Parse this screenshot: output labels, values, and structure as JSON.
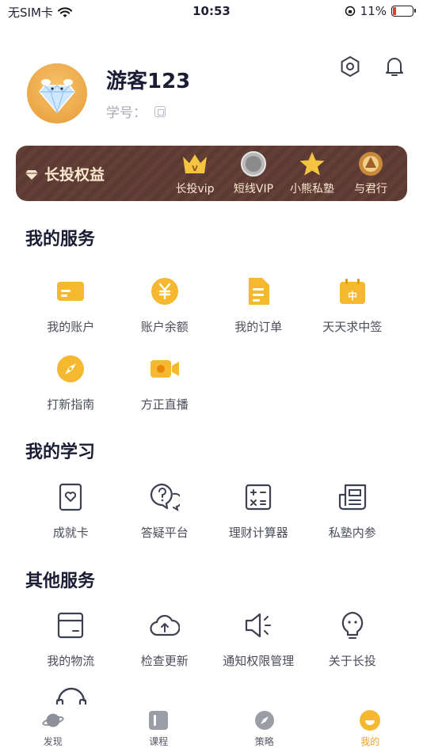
{
  "status_bar": {
    "carrier": "无SIM卡",
    "time": "10:53",
    "battery": "11%"
  },
  "profile": {
    "username": "游客123",
    "student_id_label": "学号："
  },
  "rights_banner": {
    "title": "长投权益",
    "perks": [
      {
        "label": "长投vip",
        "icon": "crown-icon"
      },
      {
        "label": "短线VIP",
        "icon": "coin-icon"
      },
      {
        "label": "小熊私塾",
        "icon": "star-icon"
      },
      {
        "label": "与君行",
        "icon": "emblem-icon"
      }
    ]
  },
  "services": {
    "title": "我的服务",
    "items": [
      {
        "label": "我的账户",
        "icon": "card-icon"
      },
      {
        "label": "账户余额",
        "icon": "yuan-coin-icon"
      },
      {
        "label": "我的订单",
        "icon": "document-icon"
      },
      {
        "label": "天天求中签",
        "icon": "calendar-icon"
      },
      {
        "label": "打新指南",
        "icon": "compass-icon"
      },
      {
        "label": "方正直播",
        "icon": "video-camera-icon"
      }
    ]
  },
  "learning": {
    "title": "我的学习",
    "items": [
      {
        "label": "成就卡",
        "icon": "heart-card-icon"
      },
      {
        "label": "答疑平台",
        "icon": "question-bubble-icon"
      },
      {
        "label": "理财计算器",
        "icon": "calculator-icon"
      },
      {
        "label": "私塾内参",
        "icon": "newspaper-icon"
      }
    ]
  },
  "other": {
    "title": "其他服务",
    "items": [
      {
        "label": "我的物流",
        "icon": "package-icon"
      },
      {
        "label": "检查更新",
        "icon": "cloud-upload-icon"
      },
      {
        "label": "通知权限管理",
        "icon": "speaker-icon"
      },
      {
        "label": "关于长投",
        "icon": "bulb-face-icon"
      }
    ]
  },
  "tab_bar": {
    "tabs": [
      {
        "label": "发现",
        "icon": "planet-icon"
      },
      {
        "label": "课程",
        "icon": "book-icon"
      },
      {
        "label": "策略",
        "icon": "compass-icon"
      },
      {
        "label": "我的",
        "icon": "smile-icon",
        "active": true
      }
    ]
  },
  "colors": {
    "accent": "#f5b82e",
    "banner": "#5a3a32",
    "banner_text": "#fbe6d0",
    "active_tab": "#f0a21e"
  }
}
